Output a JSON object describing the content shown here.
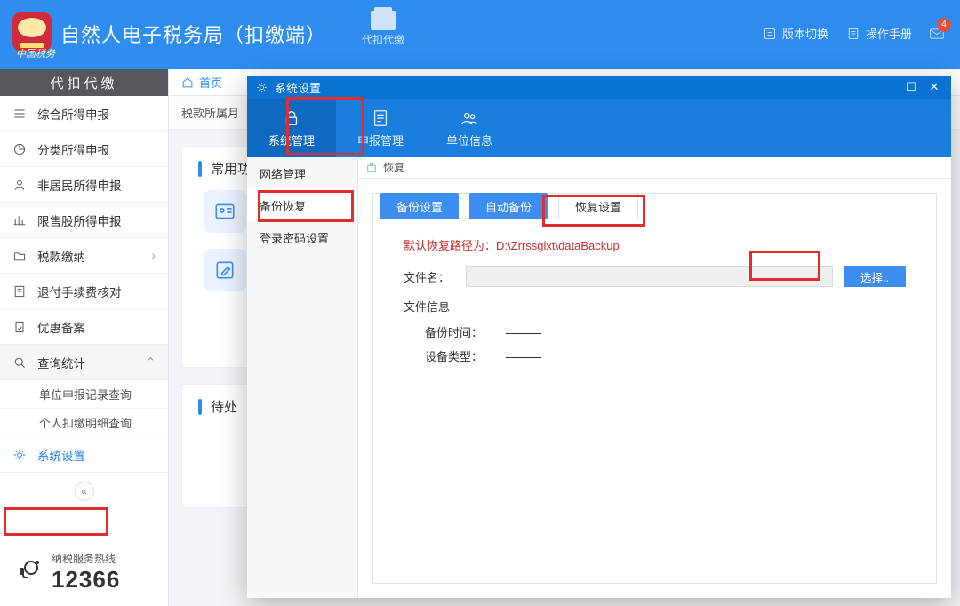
{
  "header": {
    "logo_subtext": "中国税务",
    "title": "自然人电子税务局（扣缴端）",
    "center_button": "代扣代缴",
    "links": {
      "version": "版本切换",
      "manual": "操作手册"
    },
    "mail_badge": "4"
  },
  "sidebar": {
    "title": "代扣代缴",
    "items": [
      {
        "label": "综合所得申报",
        "icon": "list-icon"
      },
      {
        "label": "分类所得申报",
        "icon": "pie-icon"
      },
      {
        "label": "非居民所得申报",
        "icon": "person-icon"
      },
      {
        "label": "限售股所得申报",
        "icon": "bars-icon"
      },
      {
        "label": "税款缴纳",
        "icon": "folder-icon",
        "chev": "›"
      },
      {
        "label": "退付手续费核对",
        "icon": "receipt-icon"
      },
      {
        "label": "优惠备案",
        "icon": "doc-icon"
      },
      {
        "label": "查询统计",
        "icon": "search-icon",
        "chev": "⌃"
      },
      {
        "label": "单位申报记录查询",
        "sub": true
      },
      {
        "label": "个人扣缴明细查询",
        "sub": true
      },
      {
        "label": "系统设置",
        "icon": "gear-icon",
        "active": true
      }
    ],
    "hotline_label": "纳税服务热线",
    "hotline_number": "12366"
  },
  "content": {
    "breadcrumb_home": "首页",
    "tax_period_label": "税款所属月",
    "section_common": "常用功能…",
    "section_pending": "待处…"
  },
  "dialog": {
    "title": "系统设置",
    "tabs": {
      "sys": "系统管理",
      "report": "申报管理",
      "org": "单位信息"
    },
    "side": {
      "network": "网络管理",
      "backup": "备份恢复",
      "pwd": "登录密码设置"
    },
    "subhead": "恢复",
    "inner_tabs": {
      "backup_set": "备份设置",
      "auto_backup": "自动备份",
      "recover_set": "恢复设置"
    },
    "hint_prefix": "默认恢复路径为：",
    "hint_path": "D:\\Zrrssglxt\\dataBackup",
    "file_label": "文件名：",
    "browse": "选择..",
    "info_title": "文件信息",
    "info_time": "备份时间：",
    "info_device": "设备类型："
  }
}
